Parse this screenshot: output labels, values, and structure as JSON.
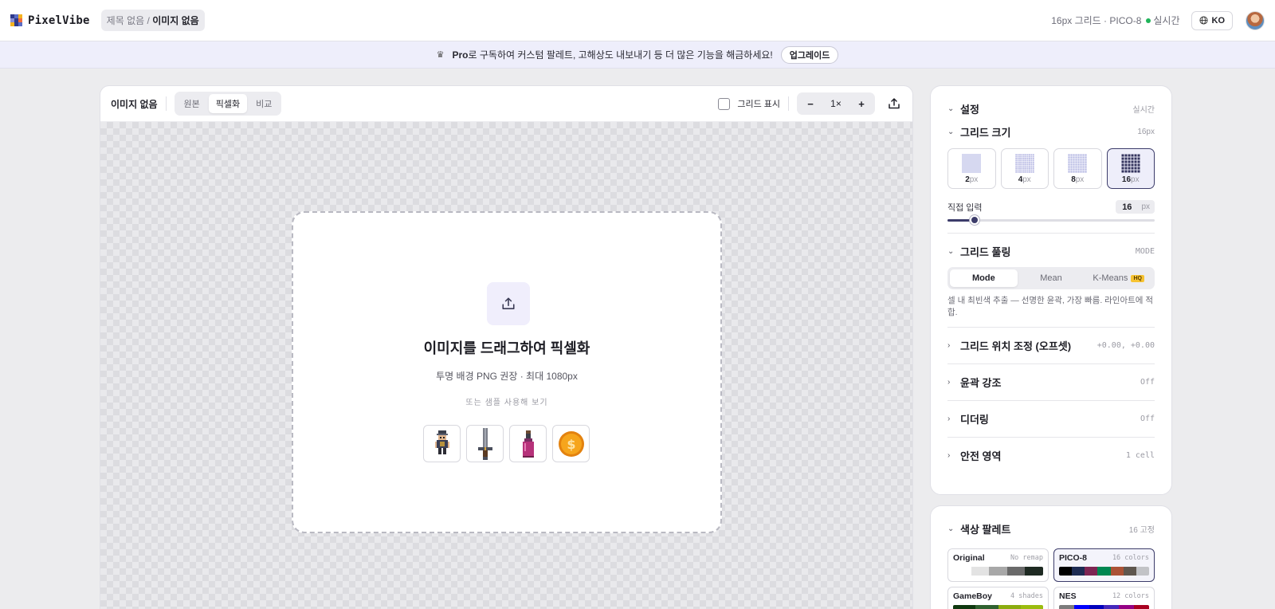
{
  "header": {
    "app_name": "PixelVibe",
    "logo_colors": [
      "#2f3a8a",
      "#5b6cc4",
      "#f5b31f",
      "#8c8fd6",
      "#2f3a8a",
      "#f26d3d",
      "#f5b31f",
      "#2f3a8a",
      "#5b6cc4"
    ],
    "crumb_project": "제목 없음 /",
    "crumb_image": "이미지 없음",
    "status_text": "16px 그리드 · PICO-8",
    "live_label": "실시간",
    "lang": "KO"
  },
  "promo": {
    "icon": "crown-icon",
    "text_bold": "Pro",
    "text": "로 구독하여 커스텀 팔레트, 고해상도 내보내기 등 더 많은 기능을 해금하세요!",
    "button": "업그레이드"
  },
  "canvas": {
    "title": "이미지 없음",
    "view_modes": [
      "원본",
      "픽셀화",
      "비교"
    ],
    "active_view": "픽셀화",
    "grid_toggle_label": "그리드 표시",
    "grid_toggle_checked": false,
    "zoom_minus": "−",
    "zoom_value": "1×",
    "zoom_plus": "+",
    "drop_title": "이미지를 드래그하여 픽셀화",
    "drop_sub": "투명 배경 PNG 권장 · 최대 1080px",
    "drop_hint": "또는 샘플 사용해 보기",
    "samples": [
      "knight-sprite",
      "sword-sprite",
      "potion-sprite",
      "coin-sprite"
    ]
  },
  "settings": {
    "title": "설정",
    "title_meta": "실시간",
    "grid_size": {
      "title": "그리드 크기",
      "meta": "16px",
      "options": [
        {
          "value": "2",
          "unit": "px"
        },
        {
          "value": "4",
          "unit": "px"
        },
        {
          "value": "8",
          "unit": "px"
        },
        {
          "value": "16",
          "unit": "px"
        }
      ],
      "selected": "16",
      "direct_label": "직접 입력",
      "direct_value": "16",
      "direct_unit": "px",
      "slider_fraction": 0.13
    },
    "pooling": {
      "title": "그리드 풀링",
      "meta": "MODE",
      "options": [
        "Mode",
        "Mean",
        "K-Means"
      ],
      "hq_badge": "HQ",
      "selected": "Mode",
      "description": "셀 내 최빈색 추출 — 선명한 윤곽, 가장 빠름. 라인아트에 적합."
    },
    "collapsed": [
      {
        "title": "그리드 위치 조정 (오프셋)",
        "meta": "+0.00, +0.00"
      },
      {
        "title": "윤곽 강조",
        "meta": "Off"
      },
      {
        "title": "디더링",
        "meta": "Off"
      },
      {
        "title": "안전 영역",
        "meta": "1 cell"
      }
    ]
  },
  "palette": {
    "title": "색상 팔레트",
    "meta": "16 고정",
    "items": [
      {
        "name": "Original",
        "meta": "No remap",
        "colors": [
          "#ffffff",
          "#e3e3e3",
          "#a8a8a8",
          "#6a6a6a",
          "#1e2a22"
        ]
      },
      {
        "name": "PICO-8",
        "meta": "16 colors",
        "colors": [
          "#000000",
          "#1d2b53",
          "#7e2553",
          "#008751",
          "#ab5236",
          "#5f574f",
          "#c2c3c7"
        ],
        "selected": true
      },
      {
        "name": "GameBoy",
        "meta": "4 shades",
        "colors": [
          "#0f380f",
          "#306230",
          "#8bac0f",
          "#9bbc0f"
        ]
      },
      {
        "name": "NES",
        "meta": "12 colors",
        "colors": [
          "#7c7c7c",
          "#0000fc",
          "#0000bc",
          "#4428bc",
          "#940084",
          "#a80020"
        ]
      }
    ]
  }
}
